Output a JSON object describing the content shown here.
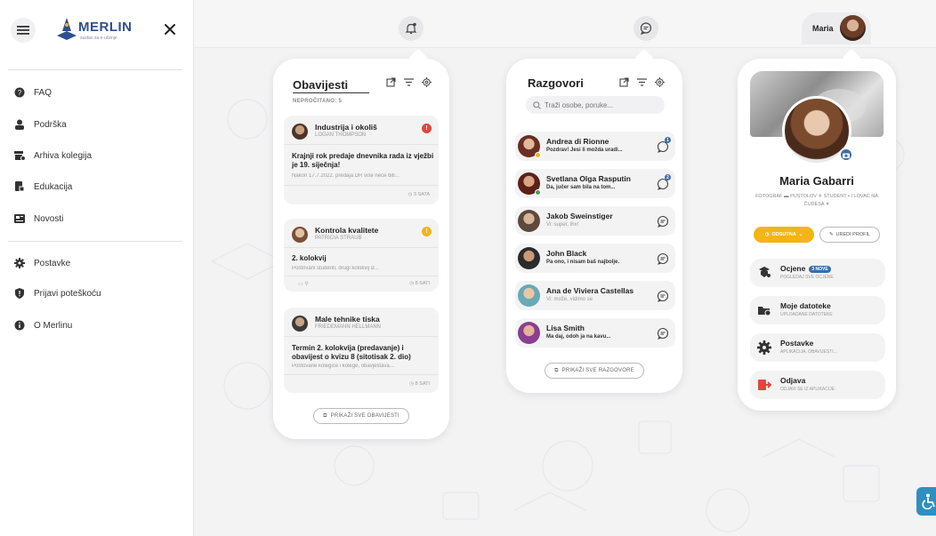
{
  "app": {
    "logo_text": "MERLIN",
    "logo_subtitle": "sustav za e-učenje"
  },
  "sidebar": {
    "items": [
      {
        "label": "FAQ",
        "icon": "faq-icon"
      },
      {
        "label": "Podrška",
        "icon": "support-icon"
      },
      {
        "label": "Arhiva kolegija",
        "icon": "archive-icon"
      },
      {
        "label": "Edukacija",
        "icon": "education-icon"
      },
      {
        "label": "Novosti",
        "icon": "news-icon"
      },
      {
        "label": "Postavke",
        "icon": "gear-icon"
      },
      {
        "label": "Prijavi poteškoću",
        "icon": "shield-icon"
      },
      {
        "label": "O Merlinu",
        "icon": "info-icon"
      }
    ]
  },
  "header": {
    "user_name": "Maria"
  },
  "notifications": {
    "title": "Obavijesti",
    "unread_label": "NEPROČITANO: 5",
    "cards": [
      {
        "course": "Industrija i okoliš",
        "teacher": "LOGAN THOMPSON",
        "alert": "!",
        "alert_color": "#e2453c",
        "message": "Krajnji rok predaje dnevnika rada iz vježbi je 19. siječnja!",
        "preview": "Nakon 17.7.2022. predaja DR više neće biti...",
        "time": "3 SATA"
      },
      {
        "course": "Kontrola kvalitete",
        "teacher": "PATRICIA STRAUB",
        "alert": "!",
        "alert_color": "#f4b416",
        "message": "2. kolokvij",
        "preview": "Poštovani studenti, drugi kolokvij iz...",
        "time": "8 SATI"
      },
      {
        "course": "Male tehnike tiska",
        "teacher": "FRIEDEMANN HELLMANN",
        "message": "Termin 2. kolokvija (predavanje) i obavijest o kvizu 8 (sitotisak 2. dio)",
        "preview": "Poštovane kolegice i kolege, obavještava...",
        "time": "8 SATI"
      }
    ],
    "show_all": "PRIKAŽI SVE OBAVIJESTI"
  },
  "chats": {
    "title": "Razgovori",
    "search_placeholder": "Traži osobe, poruke...",
    "items": [
      {
        "name": "Andrea di Rionne",
        "last": "Pozdrav! Jesi li možda uradi...",
        "unread": "1",
        "status_color": "#f4b416"
      },
      {
        "name": "Svetlana Olga Rasputin",
        "last": "Da, jučer sam bila na tom...",
        "unread": "2",
        "status_color": "#3ca55c"
      },
      {
        "name": "Jakob Sweinstiger",
        "last": "Vi: super, thx!"
      },
      {
        "name": "John Black",
        "last": "Pa ono, i nisam baš najbolje."
      },
      {
        "name": "Ana de Viviera Castellas",
        "last": "Vi: može, vidimo se"
      },
      {
        "name": "Lisa Smith",
        "last": "Ma daj, odoh ja na kavu..."
      }
    ],
    "show_all": "PRIKAŽI SVE RAZGOVORE"
  },
  "profile": {
    "name": "Maria Gabarri",
    "description": "FOTOGRAF ▬ PUSTOLOV ✈ STUDENT ▪ I LOVAC NA ČUDESA ✦",
    "status": "ODSUTNA",
    "edit": "UREDI PROFIL",
    "items": [
      {
        "title": "Ocjene",
        "badge": "3 NOVE",
        "subtitle": "POGLEDAJ SVE OCJENE",
        "icon": "grades-icon"
      },
      {
        "title": "Moje datoteke",
        "subtitle": "UPLOADANE DATOTEKE",
        "icon": "folder-icon"
      },
      {
        "title": "Postavke",
        "subtitle": "APLIKACIJA, OBAVIJESTI...",
        "icon": "gear-icon"
      },
      {
        "title": "Odjava",
        "subtitle": "ODJAVI SE IZ APLIKACIJE",
        "icon": "logout-icon"
      }
    ]
  },
  "colors": {
    "accent_blue": "#3a6ea5",
    "alert_red": "#e2453c",
    "alert_yellow": "#f4b416",
    "online_green": "#3ca55c"
  }
}
